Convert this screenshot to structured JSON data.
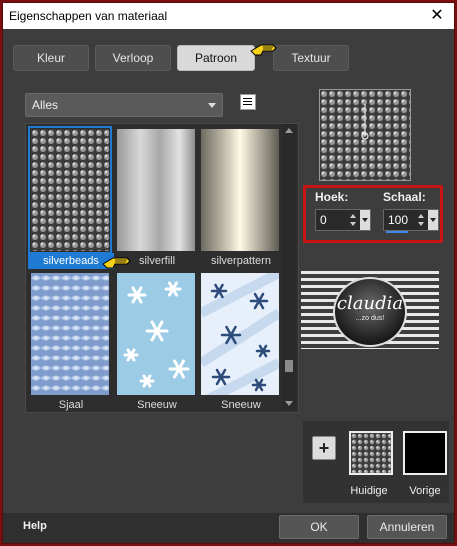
{
  "window": {
    "title": "Eigenschappen van materiaal",
    "close_glyph": "✕"
  },
  "tabs": [
    {
      "label": "Kleur"
    },
    {
      "label": "Verloop"
    },
    {
      "label": "Patroon",
      "active": true
    },
    {
      "label": "Textuur"
    }
  ],
  "filter": {
    "selected": "Alles"
  },
  "gallery": {
    "items": [
      {
        "label": "silverbeads",
        "pattern": "silverbeads",
        "selected": true
      },
      {
        "label": "silverfill",
        "pattern": "silverfill"
      },
      {
        "label": "silverpattern",
        "pattern": "silverpattern"
      },
      {
        "label": "Sjaal",
        "pattern": "sjaal"
      },
      {
        "label": "Sneeuw",
        "pattern": "sneeuw1"
      },
      {
        "label": "Sneeuw",
        "pattern": "sneeuw2"
      }
    ]
  },
  "settings": {
    "angle_label": "Hoek:",
    "angle_value": "0",
    "scale_label": "Schaal:",
    "scale_value": "100"
  },
  "logo": {
    "name": "claudia",
    "tagline": "...zo dus!"
  },
  "swatches": {
    "current_label": "Huidige",
    "previous_label": "Vorige",
    "previous_color": "#000000",
    "add_glyph": "+"
  },
  "footer": {
    "help": "Help",
    "ok": "OK",
    "cancel": "Annuleren"
  },
  "colors": {
    "selection": "#1e7ad2",
    "highlight_border": "#c81414"
  }
}
